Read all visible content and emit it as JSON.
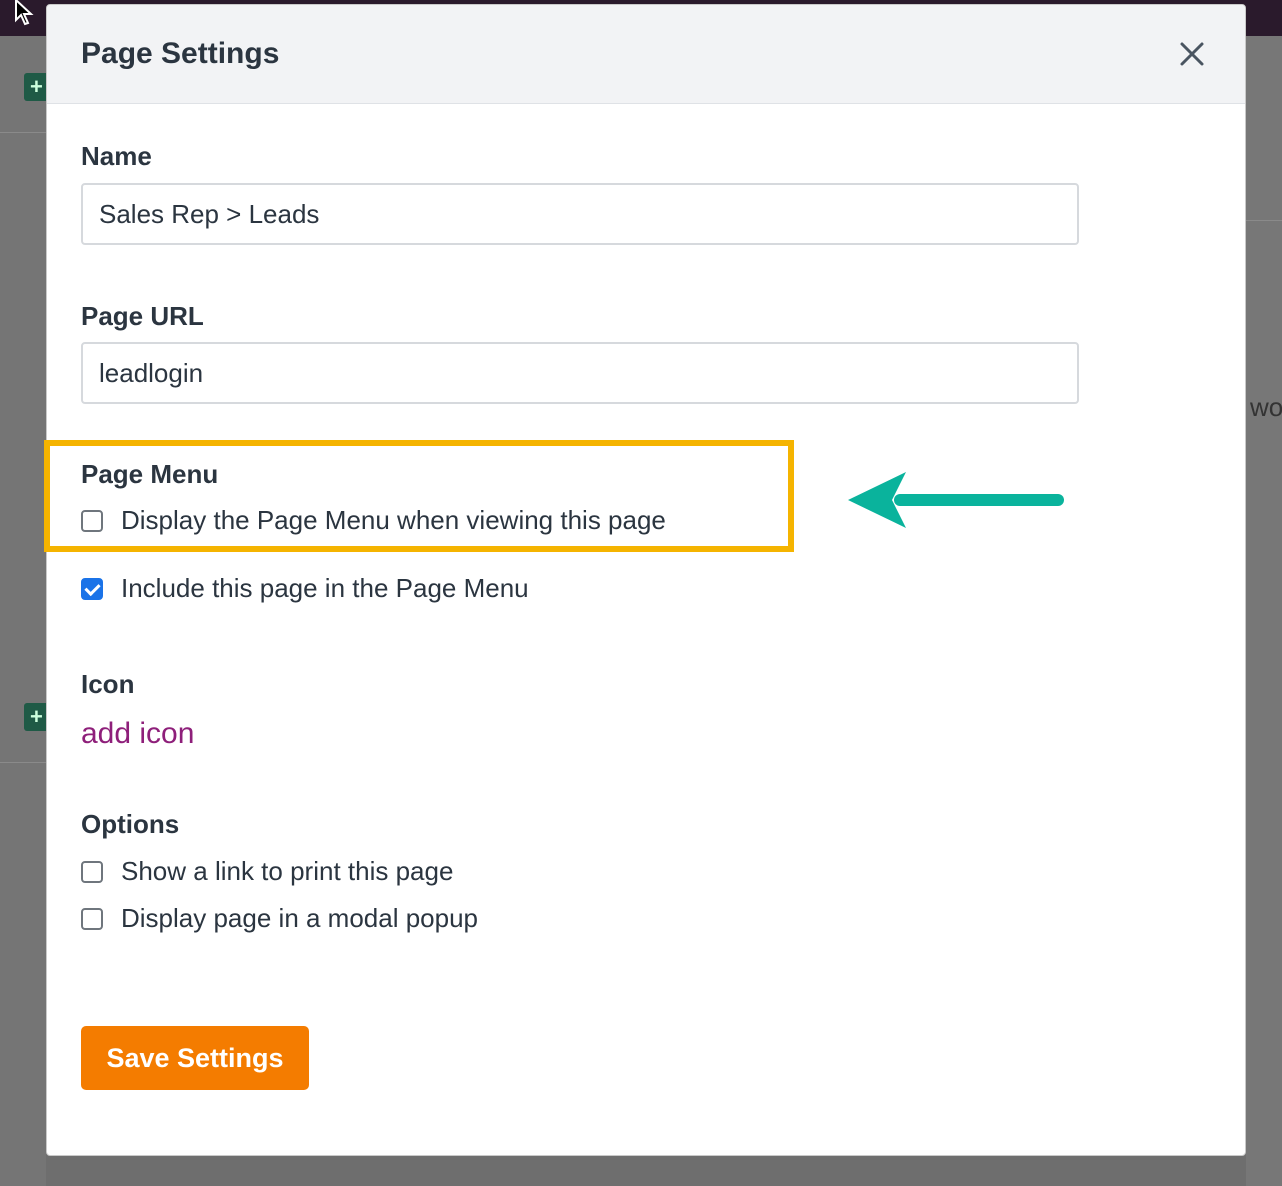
{
  "background": {
    "peek_text": "wor"
  },
  "modal": {
    "title": "Page Settings",
    "name": {
      "label": "Name",
      "value": "Sales Rep > Leads"
    },
    "page_url": {
      "label": "Page URL",
      "value": "leadlogin"
    },
    "page_menu": {
      "label": "Page Menu",
      "display_menu": {
        "label": "Display the Page Menu when viewing this page",
        "checked": false
      },
      "include_in_menu": {
        "label": "Include this page in the Page Menu",
        "checked": true
      }
    },
    "icon": {
      "label": "Icon",
      "link": "add icon"
    },
    "options": {
      "label": "Options",
      "print_link": {
        "label": "Show a link to print this page",
        "checked": false
      },
      "modal_popup": {
        "label": "Display page in a modal popup",
        "checked": false
      }
    },
    "save_label": "Save Settings"
  },
  "colors": {
    "save_button": "#f47c00",
    "highlight": "#f5b400",
    "arrow": "#0ab39c",
    "checkbox_checked": "#1a73e8",
    "link": "#8e1f7a"
  }
}
